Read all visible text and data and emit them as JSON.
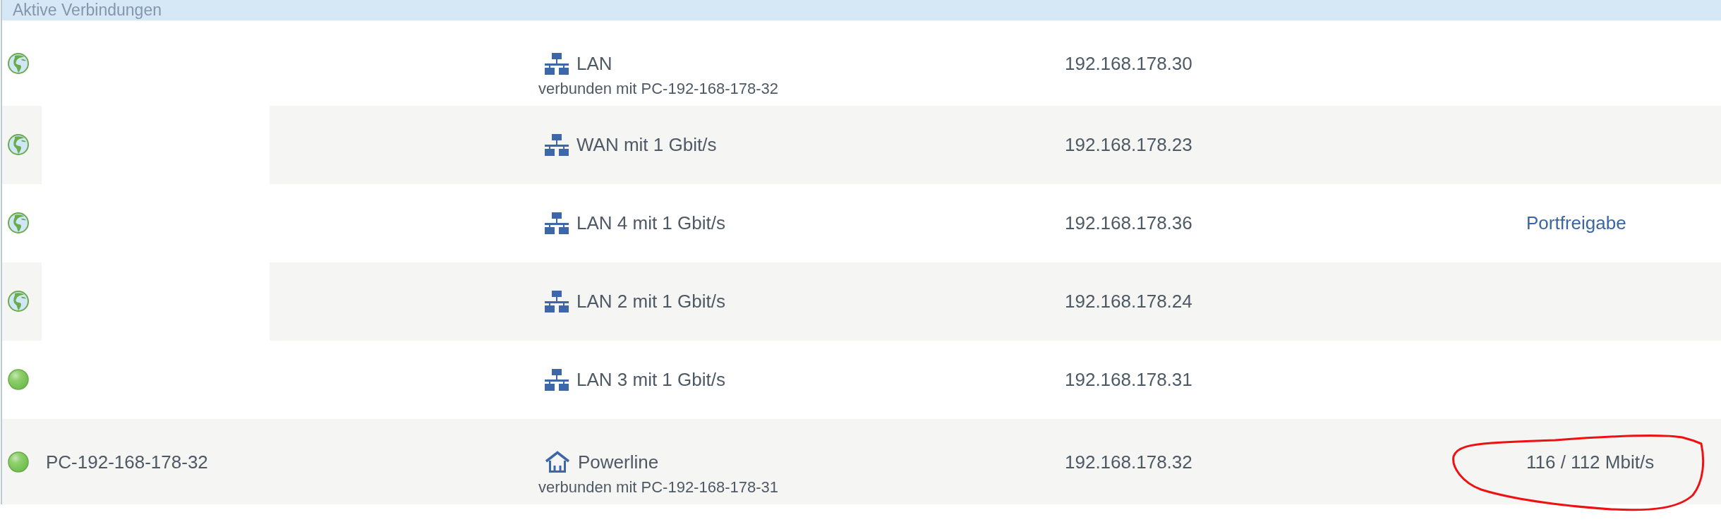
{
  "section": {
    "title": "Aktive Verbindungen"
  },
  "rows": [
    {
      "internet": true,
      "redacted": false,
      "connection": {
        "kind": "wired",
        "label": "LAN",
        "peer": "verbunden mit PC-192-168-178-32"
      },
      "ip": "192.168.178.30",
      "circled": false
    },
    {
      "internet": true,
      "redacted": true,
      "connection": {
        "kind": "wired",
        "label": "WAN mit 1 Gbit/s"
      },
      "ip": "192.168.178.23",
      "circled": false
    },
    {
      "internet": true,
      "redacted": false,
      "connection": {
        "kind": "wired",
        "label": "LAN 4 mit 1 Gbit/s"
      },
      "ip": "192.168.178.36",
      "link": "Portfreigabe",
      "circled": false
    },
    {
      "internet": true,
      "redacted": true,
      "connection": {
        "kind": "wired",
        "label": "LAN 2 mit 1 Gbit/s"
      },
      "ip": "192.168.178.24",
      "circled": false
    },
    {
      "internet": false,
      "redacted": false,
      "connection": {
        "kind": "wired",
        "label": "LAN 3 mit 1 Gbit/s"
      },
      "ip": "192.168.178.31",
      "circled": false
    },
    {
      "internet": false,
      "redacted": false,
      "name": "PC-192-168-178-32",
      "connection": {
        "kind": "powerline",
        "label": "Powerline",
        "peer": "verbunden mit PC-192-168-178-31"
      },
      "ip": "192.168.178.32",
      "speed": "116 / 112 Mbit/s",
      "circled": true
    }
  ]
}
